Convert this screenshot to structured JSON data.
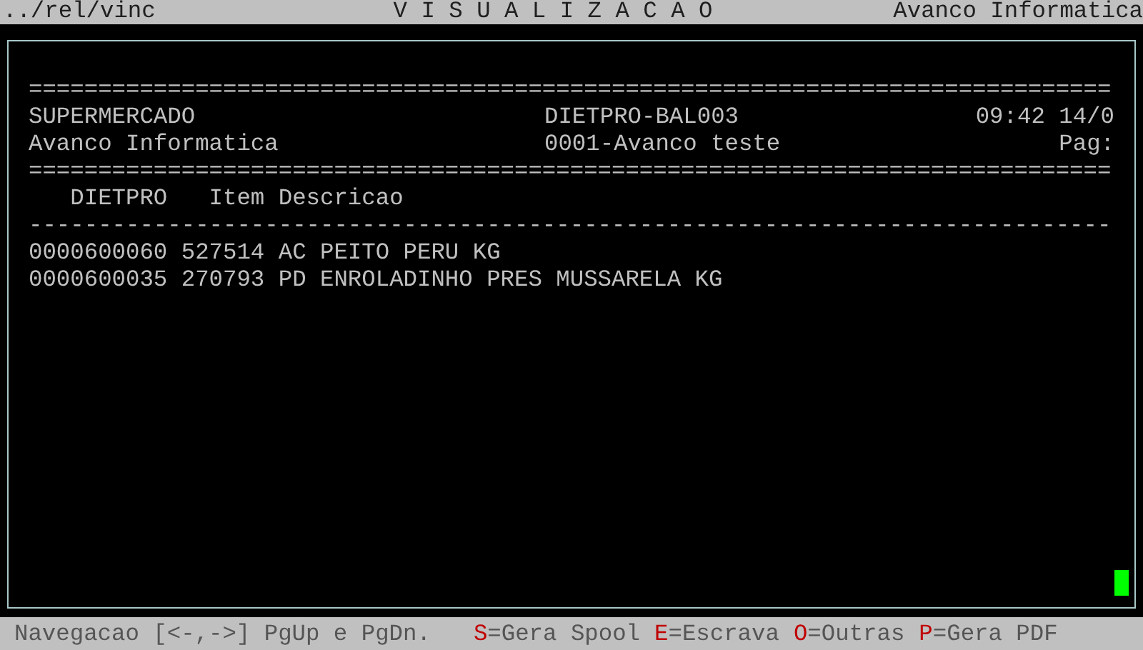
{
  "title_bar": {
    "path": "../rel/vinc",
    "title": "V I S U A L I Z A C A O",
    "company": "Avanco Informatica"
  },
  "report": {
    "rule_top": "==============================================================================",
    "header": [
      {
        "left": "SUPERMERCADO",
        "middle": "DIETPRO-BAL003",
        "right": "09:42 14/0"
      },
      {
        "left": "Avanco Informatica",
        "middle": "0001-Avanco teste",
        "right": "Pag:"
      }
    ],
    "rule_mid": "==============================================================================",
    "columns": "   DIETPRO   Item Descricao",
    "rule_columns": "------------------------------------------------------------------------------",
    "rows": [
      "0000600060 527514 AC PEITO PERU KG",
      "0000600035 270793 PD ENROLADINHO PRES MUSSARELA KG"
    ]
  },
  "status_bar": {
    "navigation": "Navegacao [<-,->] PgUp e PgDn.",
    "shortcuts": [
      {
        "key": "S",
        "label": "=Gera Spool"
      },
      {
        "key": "E",
        "label": "=Escrava"
      },
      {
        "key": "O",
        "label": "=Outras"
      },
      {
        "key": "P",
        "label": "=Gera PDF"
      }
    ]
  }
}
